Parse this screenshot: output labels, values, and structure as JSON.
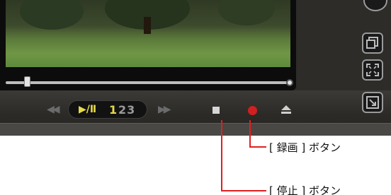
{
  "player": {
    "controls": {
      "rewind_icon": "rewind-icon",
      "play_pause_label": "▶/Ⅱ",
      "channel_active": "1",
      "channel_rest": "23",
      "fast_forward_icon": "fast-forward-icon",
      "stop_icon": "stop-icon",
      "record_icon": "record-icon",
      "eject_icon": "eject-icon"
    },
    "side_buttons": [
      "window-icon",
      "fullscreen-icon",
      "resize-icon"
    ],
    "colors": {
      "record": "#d21f1f",
      "play_label": "#e6d94a",
      "callout_line": "#e02020"
    }
  },
  "callouts": {
    "record": "[ 録画 ] ボタン",
    "stop": "[ 停止 ] ボタン"
  }
}
